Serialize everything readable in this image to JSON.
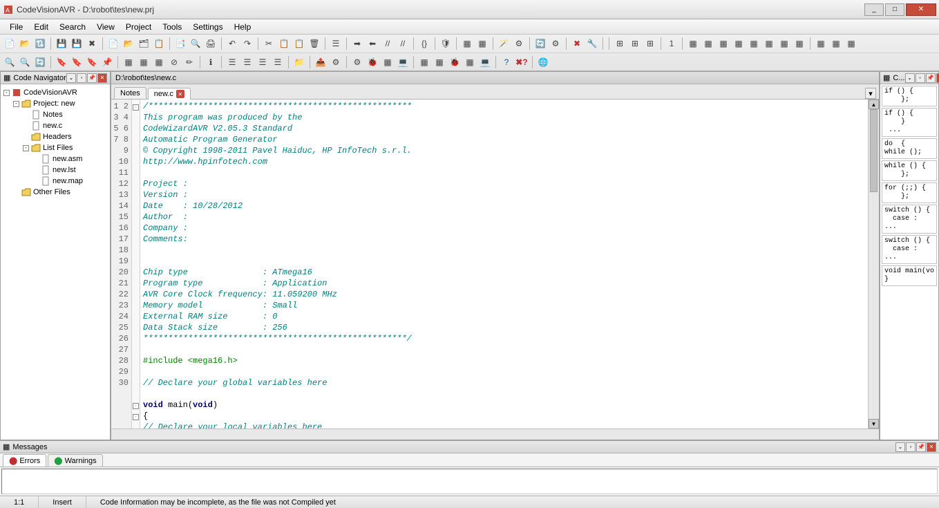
{
  "window": {
    "title": "CodeVisionAVR - D:\\robot\\tes\\new.prj",
    "min": "_",
    "max": "□",
    "close": "✕"
  },
  "menu": [
    "File",
    "Edit",
    "Search",
    "View",
    "Project",
    "Tools",
    "Settings",
    "Help"
  ],
  "navigator": {
    "title": "Code Navigator",
    "root": "CodeVisionAVR",
    "project": "Project: new",
    "items": {
      "notes": "Notes",
      "newc": "new.c",
      "headers": "Headers",
      "listfiles": "List Files",
      "newasm": "new.asm",
      "newlst": "new.lst",
      "newmap": "new.map",
      "otherfiles": "Other Files"
    }
  },
  "editor": {
    "path": "D:\\robot\\tes\\new.c",
    "tabs": [
      {
        "label": "Notes",
        "active": false,
        "closable": false
      },
      {
        "label": "new.c",
        "active": true,
        "closable": true
      }
    ]
  },
  "code": {
    "lines": [
      {
        "n": 1,
        "fold": "-",
        "cls": "comment",
        "t": "/*****************************************************"
      },
      {
        "n": 2,
        "cls": "comment",
        "t": "This program was produced by the"
      },
      {
        "n": 3,
        "cls": "comment",
        "t": "CodeWizardAVR V2.05.3 Standard"
      },
      {
        "n": 4,
        "cls": "comment",
        "t": "Automatic Program Generator"
      },
      {
        "n": 5,
        "cls": "comment",
        "t": "© Copyright 1998-2011 Pavel Haiduc, HP InfoTech s.r.l."
      },
      {
        "n": 6,
        "cls": "comment",
        "t": "http://www.hpinfotech.com"
      },
      {
        "n": 7,
        "cls": "comment",
        "t": ""
      },
      {
        "n": 8,
        "cls": "comment",
        "t": "Project : "
      },
      {
        "n": 9,
        "cls": "comment",
        "t": "Version : "
      },
      {
        "n": 10,
        "cls": "comment",
        "t": "Date    : 10/28/2012"
      },
      {
        "n": 11,
        "cls": "comment",
        "t": "Author  : "
      },
      {
        "n": 12,
        "cls": "comment",
        "t": "Company : "
      },
      {
        "n": 13,
        "cls": "comment",
        "t": "Comments: "
      },
      {
        "n": 14,
        "cls": "comment",
        "t": ""
      },
      {
        "n": 15,
        "cls": "comment",
        "t": ""
      },
      {
        "n": 16,
        "cls": "comment",
        "t": "Chip type               : ATmega16"
      },
      {
        "n": 17,
        "cls": "comment",
        "t": "Program type            : Application"
      },
      {
        "n": 18,
        "cls": "comment",
        "t": "AVR Core Clock frequency: 11.059200 MHz"
      },
      {
        "n": 19,
        "cls": "comment",
        "t": "Memory model            : Small"
      },
      {
        "n": 20,
        "cls": "comment",
        "t": "External RAM size       : 0"
      },
      {
        "n": 21,
        "cls": "comment",
        "t": "Data Stack size         : 256"
      },
      {
        "n": 22,
        "cls": "comment",
        "t": "*****************************************************/"
      },
      {
        "n": 23,
        "cls": "",
        "t": ""
      },
      {
        "n": 24,
        "cls": "pre-dir",
        "t": "#include <mega16.h>"
      },
      {
        "n": 25,
        "cls": "",
        "t": ""
      },
      {
        "n": 26,
        "cls": "comment",
        "t": "// Declare your global variables here"
      },
      {
        "n": 27,
        "cls": "",
        "t": ""
      },
      {
        "n": 28,
        "fold": "-",
        "cls": "",
        "t": "void main(void)"
      },
      {
        "n": 29,
        "fold": "-",
        "cls": "",
        "t": "{"
      },
      {
        "n": 30,
        "cls": "comment",
        "t": "// Declare your local variables here"
      }
    ]
  },
  "templates": {
    "title": "C...",
    "items": [
      "if () {\n    };",
      "if () {\n    }\n ...",
      "do  {\nwhile ();",
      "while () {\n    };",
      "for (;;) {\n    };",
      "switch () {\n  case :\n...",
      "switch () {\n  case :\n...",
      "void main(vo\n}"
    ]
  },
  "messages": {
    "title": "Messages",
    "tabs": [
      {
        "label": "Errors",
        "active": true
      },
      {
        "label": "Warnings",
        "active": false
      }
    ]
  },
  "status": {
    "pos": "1:1",
    "mode": "Insert",
    "info": "Code Information may be incomplete, as the file was not Compiled yet"
  }
}
